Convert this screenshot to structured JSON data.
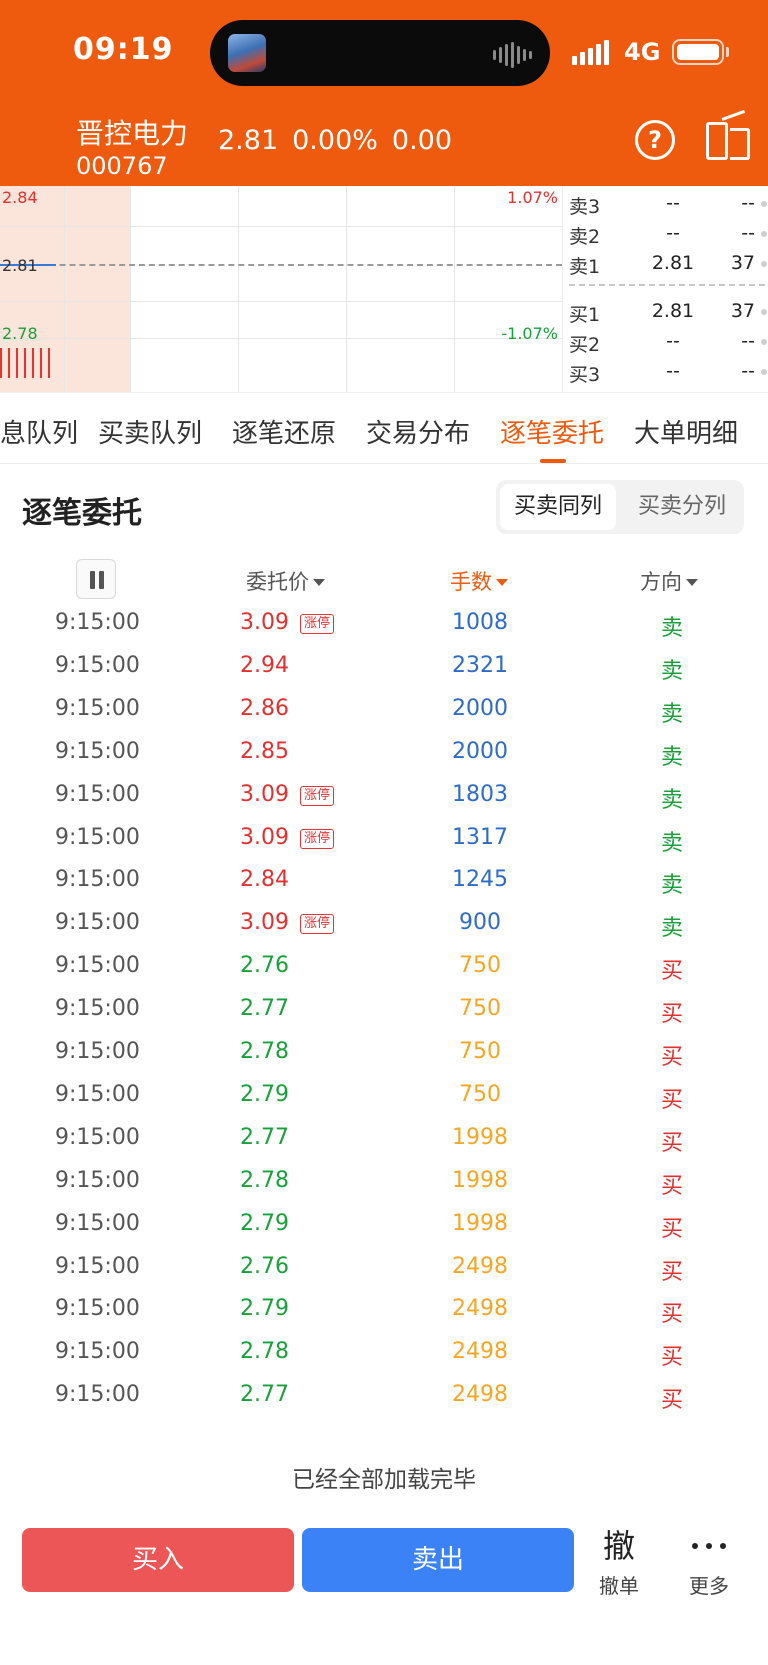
{
  "status": {
    "time": "09:19",
    "network": "4G"
  },
  "header": {
    "stock_name": "晋控电力",
    "stock_code": "000767",
    "price": "2.81",
    "change_pct": "0.00%",
    "change": "0.00",
    "help_icon": "?"
  },
  "chart": {
    "high": "2.84",
    "mid": "2.81",
    "low": "2.78",
    "pct_up": "1.07%",
    "pct_down": "-1.07%"
  },
  "order_book": {
    "asks": [
      {
        "label": "卖3",
        "price": "--",
        "vol": "--"
      },
      {
        "label": "卖2",
        "price": "--",
        "vol": "--"
      },
      {
        "label": "卖1",
        "price": "2.81",
        "vol": "37"
      }
    ],
    "bids": [
      {
        "label": "买1",
        "price": "2.81",
        "vol": "37"
      },
      {
        "label": "买2",
        "price": "--",
        "vol": "--"
      },
      {
        "label": "买3",
        "price": "--",
        "vol": "--"
      }
    ]
  },
  "tabs": [
    "息队列",
    "买卖队列",
    "逐笔还原",
    "交易分布",
    "逐笔委托",
    "大单明细"
  ],
  "section": {
    "title": "逐笔委托",
    "seg_on": "买卖同列",
    "seg_off": "买卖分列"
  },
  "columns": {
    "price": "委托价",
    "qty": "手数",
    "dir": "方向"
  },
  "rows": [
    {
      "time": "9:15:00",
      "price": "3.09",
      "limit": "涨停",
      "qty": "1008",
      "dir": "卖"
    },
    {
      "time": "9:15:00",
      "price": "2.94",
      "limit": "",
      "qty": "2321",
      "dir": "卖"
    },
    {
      "time": "9:15:00",
      "price": "2.86",
      "limit": "",
      "qty": "2000",
      "dir": "卖"
    },
    {
      "time": "9:15:00",
      "price": "2.85",
      "limit": "",
      "qty": "2000",
      "dir": "卖"
    },
    {
      "time": "9:15:00",
      "price": "3.09",
      "limit": "涨停",
      "qty": "1803",
      "dir": "卖"
    },
    {
      "time": "9:15:00",
      "price": "3.09",
      "limit": "涨停",
      "qty": "1317",
      "dir": "卖"
    },
    {
      "time": "9:15:00",
      "price": "2.84",
      "limit": "",
      "qty": "1245",
      "dir": "卖"
    },
    {
      "time": "9:15:00",
      "price": "3.09",
      "limit": "涨停",
      "qty": "900",
      "dir": "卖"
    },
    {
      "time": "9:15:00",
      "price": "2.76",
      "limit": "",
      "qty": "750",
      "dir": "买"
    },
    {
      "time": "9:15:00",
      "price": "2.77",
      "limit": "",
      "qty": "750",
      "dir": "买"
    },
    {
      "time": "9:15:00",
      "price": "2.78",
      "limit": "",
      "qty": "750",
      "dir": "买"
    },
    {
      "time": "9:15:00",
      "price": "2.79",
      "limit": "",
      "qty": "750",
      "dir": "买"
    },
    {
      "time": "9:15:00",
      "price": "2.77",
      "limit": "",
      "qty": "1998",
      "dir": "买"
    },
    {
      "time": "9:15:00",
      "price": "2.78",
      "limit": "",
      "qty": "1998",
      "dir": "买"
    },
    {
      "time": "9:15:00",
      "price": "2.79",
      "limit": "",
      "qty": "1998",
      "dir": "买"
    },
    {
      "time": "9:15:00",
      "price": "2.76",
      "limit": "",
      "qty": "2498",
      "dir": "买"
    },
    {
      "time": "9:15:00",
      "price": "2.79",
      "limit": "",
      "qty": "2498",
      "dir": "买"
    },
    {
      "time": "9:15:00",
      "price": "2.78",
      "limit": "",
      "qty": "2498",
      "dir": "买"
    },
    {
      "time": "9:15:00",
      "price": "2.77",
      "limit": "",
      "qty": "2498",
      "dir": "买"
    }
  ],
  "footer_text": "已经全部加载完毕",
  "bottom": {
    "buy": "买入",
    "sell": "卖出",
    "cancel_icon": "撤",
    "cancel": "撤单",
    "more": "更多"
  },
  "colors": {
    "brand": "#EE5A0E",
    "up": "#E42F2F",
    "down": "#18A03A",
    "sell_qty": "#2E6BC9",
    "buy_qty": "#F5A623"
  }
}
